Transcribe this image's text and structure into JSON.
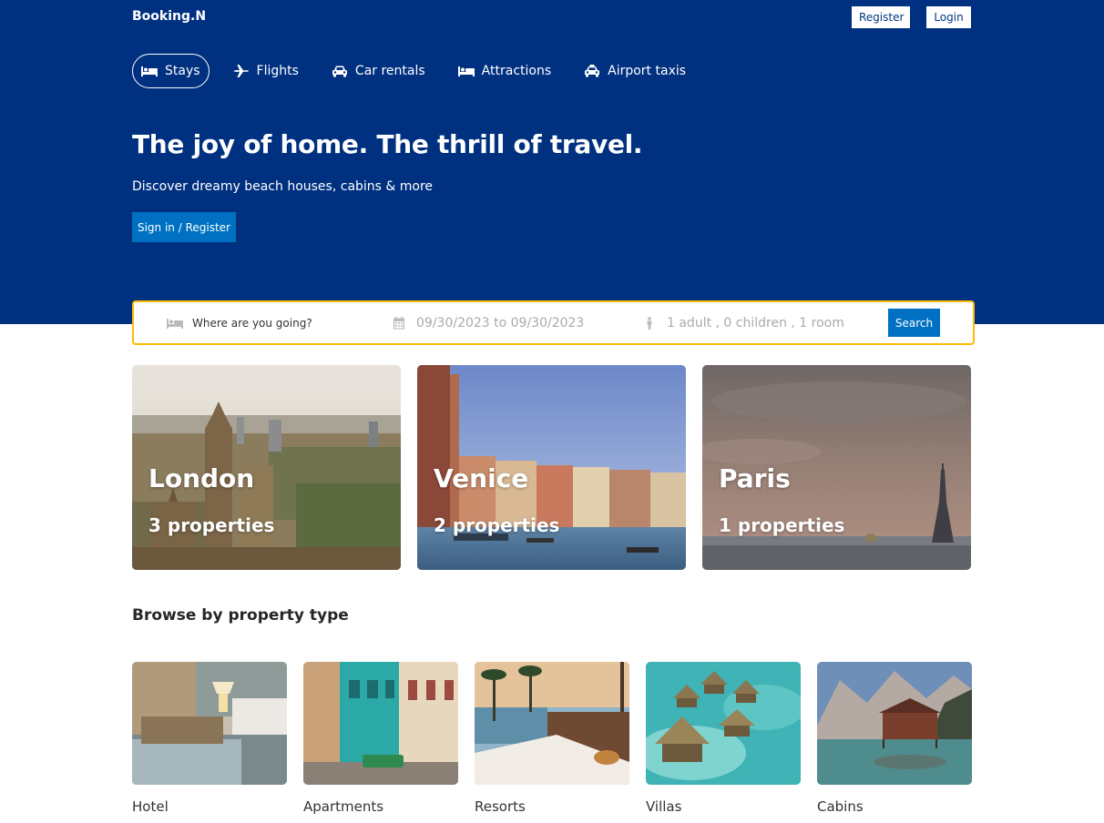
{
  "brand": "Booking.N",
  "auth": {
    "register_label": "Register",
    "login_label": "Login"
  },
  "nav": [
    {
      "label": "Stays",
      "icon": "bed-icon",
      "active": true
    },
    {
      "label": "Flights",
      "icon": "plane-icon",
      "active": false
    },
    {
      "label": "Car rentals",
      "icon": "car-icon",
      "active": false
    },
    {
      "label": "Attractions",
      "icon": "bed-icon",
      "active": false
    },
    {
      "label": "Airport taxis",
      "icon": "taxi-icon",
      "active": false
    }
  ],
  "hero": {
    "title": "The joy of home. The thrill of travel.",
    "subtitle": "Discover dreamy beach houses, cabins & more",
    "signin_label": "Sign in / Register"
  },
  "search": {
    "destination_placeholder": "Where are you going?",
    "date_range": "09/30/2023 to 09/30/2023",
    "guests": "1 adult , 0 children , 1 room",
    "search_label": "Search"
  },
  "featured": [
    {
      "city": "London",
      "properties": "3 properties"
    },
    {
      "city": "Venice",
      "properties": "2 properties"
    },
    {
      "city": "Paris",
      "properties": "1 properties"
    }
  ],
  "property_types": {
    "title": "Browse by property type",
    "items": [
      {
        "label": "Hotel"
      },
      {
        "label": "Apartments"
      },
      {
        "label": "Resorts"
      },
      {
        "label": "Villas"
      },
      {
        "label": "Cabins"
      }
    ]
  },
  "colors": {
    "brand_blue": "#003580",
    "action_blue": "#0071c2",
    "search_border": "#febb02"
  }
}
